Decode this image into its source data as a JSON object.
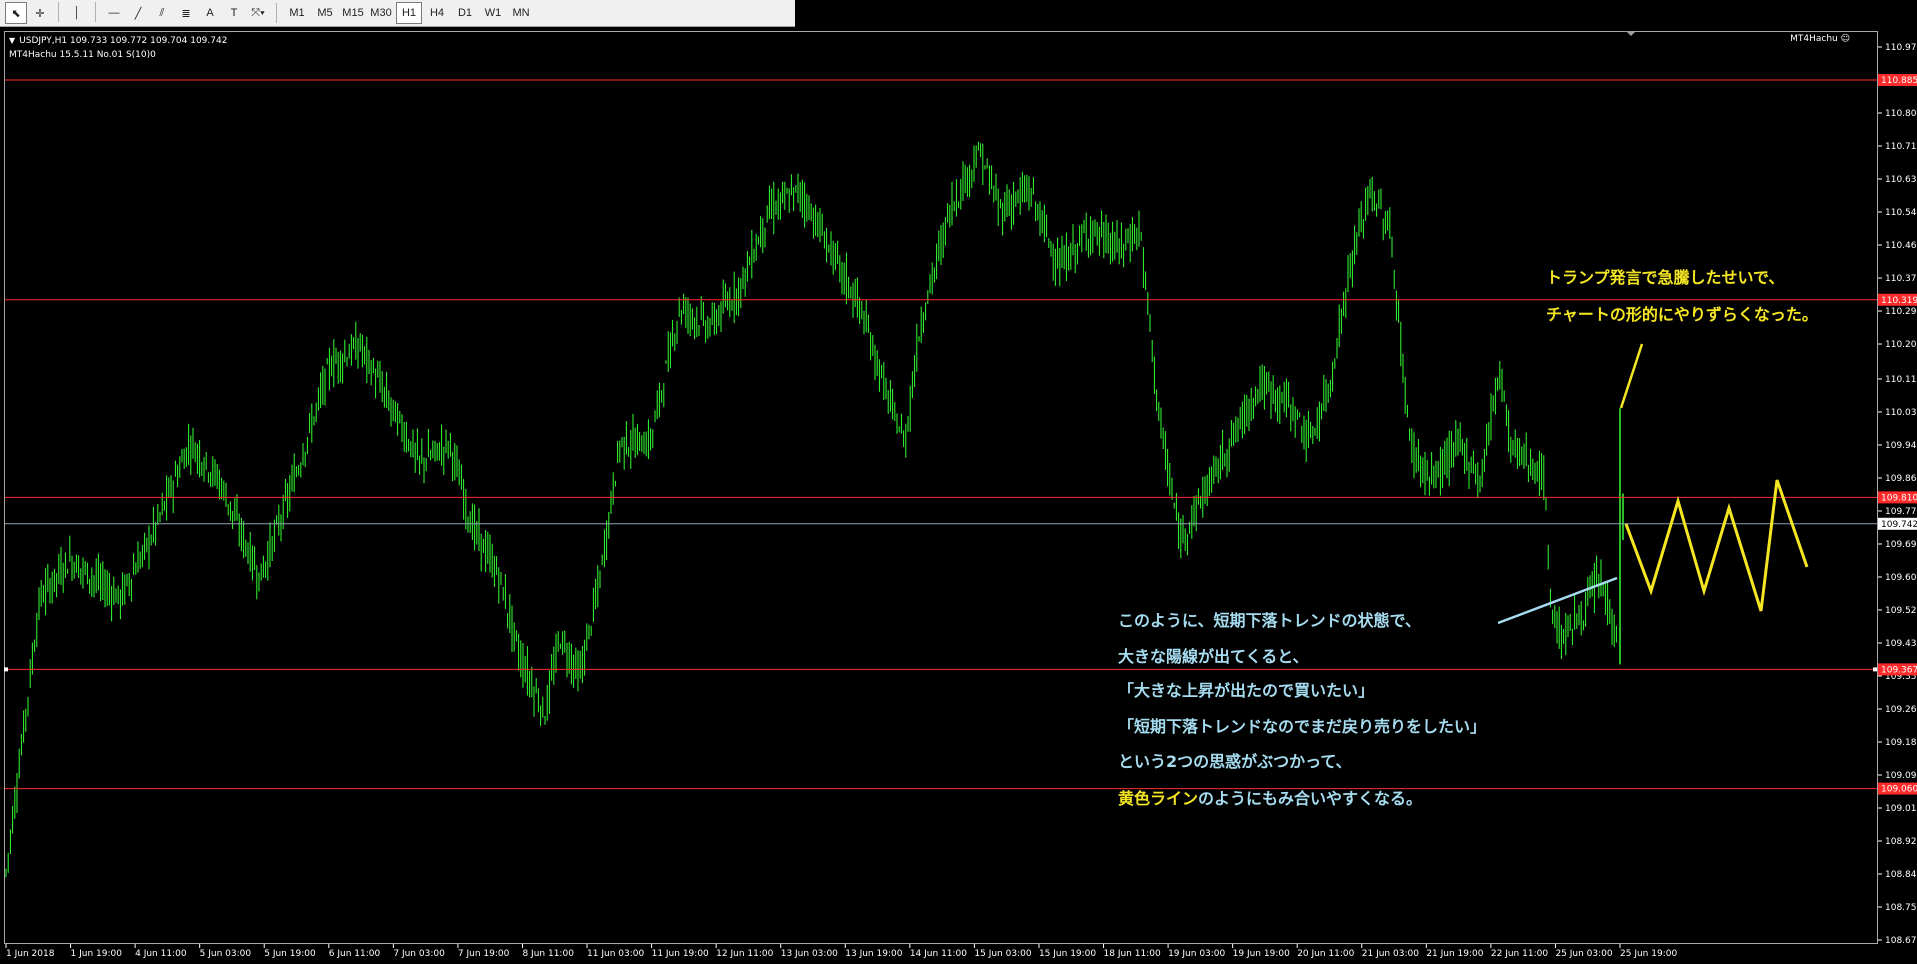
{
  "toolbar": {
    "tools": [
      {
        "name": "cursor-icon",
        "glyph": "⬉"
      },
      {
        "name": "crosshair-icon",
        "glyph": "✛"
      },
      {
        "name": "vertical-line-icon",
        "glyph": "│"
      },
      {
        "name": "horizontal-line-icon",
        "glyph": "—"
      },
      {
        "name": "trendline-icon",
        "glyph": "╱"
      },
      {
        "name": "equidistant-channel-icon",
        "glyph": "⫽"
      },
      {
        "name": "fibonacci-icon",
        "glyph": "≣"
      },
      {
        "name": "text-icon",
        "glyph": "A"
      },
      {
        "name": "text-label-icon",
        "glyph": "T"
      },
      {
        "name": "shapes-dropdown-icon",
        "glyph": "⤧▾"
      }
    ],
    "timeframes": [
      "M1",
      "M5",
      "M15",
      "M30",
      "H1",
      "H4",
      "D1",
      "W1",
      "MN"
    ],
    "active_timeframe": "H1"
  },
  "chart": {
    "info_line1": "USDJPY,H1  109.733 109.772 109.704 109.742",
    "info_line2": "MT4Hachu 15.5.11   No.01  S(10)0",
    "ea_name": "MT4Hachu ☺",
    "price_ticks": [
      "110.970",
      "110.885",
      "110.800",
      "110.715",
      "110.630",
      "110.545",
      "110.460",
      "110.375",
      "110.290",
      "110.205",
      "110.115",
      "110.030",
      "109.945",
      "109.860",
      "109.775",
      "109.690",
      "109.605",
      "109.520",
      "109.435",
      "109.350",
      "109.265",
      "109.180",
      "109.095",
      "109.010",
      "108.925",
      "108.840",
      "108.755",
      "108.670"
    ],
    "time_ticks": [
      "1 Jun 2018",
      "1 Jun 19:00",
      "4 Jun 11:00",
      "5 Jun 03:00",
      "5 Jun 19:00",
      "6 Jun 11:00",
      "7 Jun 03:00",
      "7 Jun 19:00",
      "8 Jun 11:00",
      "11 Jun 03:00",
      "11 Jun 19:00",
      "12 Jun 11:00",
      "13 Jun 03:00",
      "13 Jun 19:00",
      "14 Jun 11:00",
      "15 Jun 03:00",
      "15 Jun 19:00",
      "18 Jun 11:00",
      "19 Jun 03:00",
      "19 Jun 19:00",
      "20 Jun 11:00",
      "21 Jun 03:00",
      "21 Jun 19:00",
      "22 Jun 11:00",
      "25 Jun 03:00",
      "25 Jun 19:00"
    ],
    "hlines": [
      {
        "price": 110.885,
        "label": "110.885",
        "color": "#ff2a2a"
      },
      {
        "price": 110.319,
        "label": "110.319",
        "color": "#ff2a2a"
      },
      {
        "price": 109.81,
        "label": "109.810",
        "color": "#ff2a2a"
      },
      {
        "price": 109.367,
        "label": "109.367",
        "color": "#ff2a2a"
      },
      {
        "price": 109.06,
        "label": "109.060",
        "color": "#ff2a2a"
      }
    ],
    "current_price": {
      "value": 109.742,
      "label": "109.742",
      "color": "#8fa3b5"
    },
    "colors": {
      "candle": "#33ff33",
      "grid_line": "#ff2a2a",
      "annot_line_blue": "#a6dcf0",
      "annot_line_yellow": "#f5e623"
    }
  },
  "annotations": {
    "blue": [
      "このように、短期下落トレンドの状態で、",
      "大きな陽線が出てくると、",
      "「大きな上昇が出たので買いたい」",
      "「短期下落トレンドなのでまだ戻り売りをしたい」",
      "という2つの思惑がぶつかって、"
    ],
    "last_line_yellow_part": "黄色ライン",
    "last_line_blue_part": "のようにもみ合いやすくなる。",
    "yellow": [
      "トランプ発言で急騰したせいで、",
      "チャートの形的にやりずらくなった。"
    ]
  }
}
